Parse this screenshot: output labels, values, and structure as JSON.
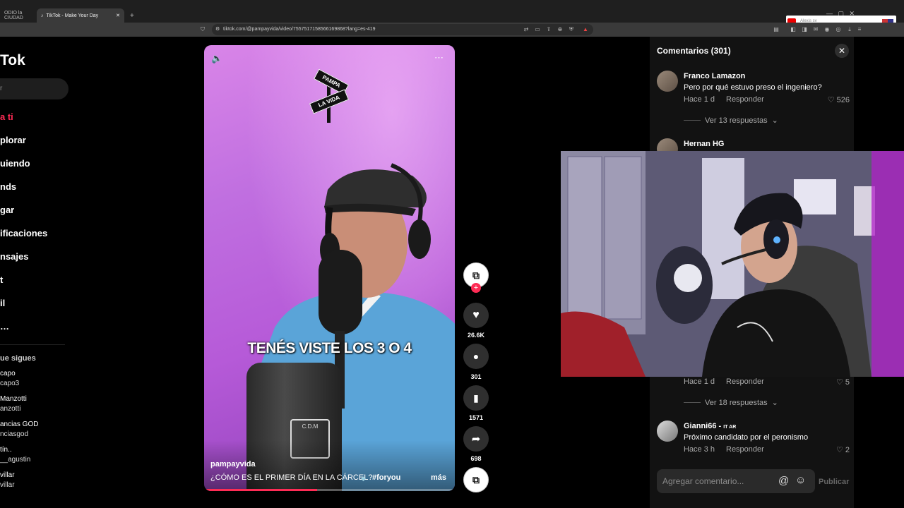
{
  "browser": {
    "tabs": [
      {
        "label": "ODIO la CIUDAD"
      },
      {
        "label": "TikTok - Make Your Day"
      }
    ],
    "new_tab": "+",
    "url": "tiktok.com/@pampayvida/video/7557517158566169868?lang=es-419",
    "notification_name": "Alexis sv"
  },
  "sidebar": {
    "logo": "Tok",
    "search_placeholder": "r",
    "items": [
      {
        "label": "a ti",
        "active": true
      },
      {
        "label": "plorar"
      },
      {
        "label": "uiendo"
      },
      {
        "label": "nds"
      },
      {
        "label": "gar"
      },
      {
        "label": "ificaciones"
      },
      {
        "label": "nsajes"
      },
      {
        "label": "t"
      },
      {
        "label": "il"
      },
      {
        "label": "…"
      }
    ],
    "following_title": "ue sigues",
    "following": [
      {
        "name": "capo",
        "user": "capo3"
      },
      {
        "name": "Manzotti",
        "user": "anzotti"
      },
      {
        "name": "ancias GOD",
        "user": "nciasgod"
      },
      {
        "name": "tín..",
        "user": "__agustin"
      },
      {
        "name": "villar",
        "user": "villar"
      }
    ]
  },
  "video": {
    "caption_overlay": "TENÉS VISTE LOS 3 O 4",
    "sign_top": "PAMPA",
    "sign_bottom": "LA VIDA",
    "author": "pampayvida",
    "description": "¿CÓMO ES EL PRIMER DÍA EN LA CÁRCEL?",
    "hashtag": "#foryou",
    "more": "más",
    "progress": 0.45
  },
  "actions": {
    "likes": "26.6K",
    "comments": "301",
    "saves": "1571",
    "shares": "698"
  },
  "comments": {
    "title": "Comentarios (301)",
    "list": [
      {
        "name": "Franco Lamazon",
        "text": "Pero por qué estuvo preso el ingeniero?",
        "time": "Hace 1 d",
        "reply": "Responder",
        "likes": "526",
        "more": "Ver 13 respuestas"
      },
      {
        "name": "Hernan HG"
      },
      {
        "time": "Hace 1 d",
        "reply": "Responder",
        "likes": "5",
        "more": "Ver 18 respuestas"
      },
      {
        "name": "Gianni66",
        "badge": "IT AR",
        "text": "Próximo candidato por el peronismo",
        "time": "Hace 3 h",
        "reply": "Responder",
        "likes": "2"
      }
    ],
    "input_placeholder": "Agregar comentario...",
    "publish": "Publicar"
  },
  "colors": {
    "accent": "#fe2c55",
    "panel": "#121212",
    "video_bg": "#c06fe0"
  }
}
